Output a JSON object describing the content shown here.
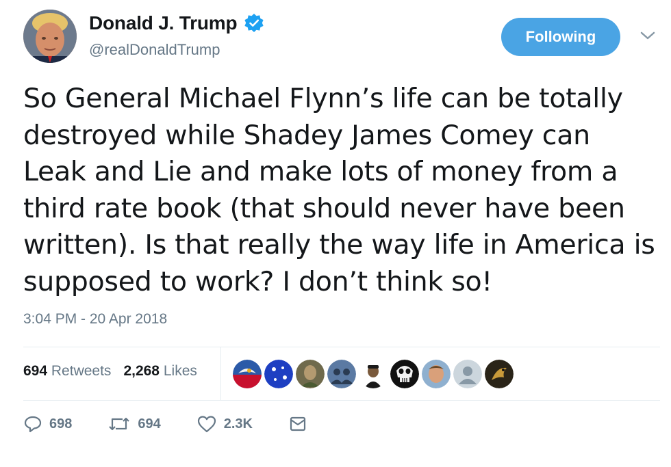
{
  "author": {
    "display_name": "Donald J. Trump",
    "handle": "@realDonaldTrump",
    "verified": true,
    "avatar_icon": "profile-photo"
  },
  "follow_button": {
    "label": "Following",
    "color": "#4aa4e4"
  },
  "tweet": {
    "text": "So General Michael Flynn’s life can be totally destroyed while Shadey James Comey can Leak and Lie and make lots of money from a third rate book (that should never have been written). Is that really the way life in America is supposed to work? I don’t think so!",
    "timestamp": "3:04 PM - 20 Apr 2018"
  },
  "stats": {
    "retweets_count": "694",
    "retweets_label": "Retweets",
    "likes_count": "2,268",
    "likes_label": "Likes"
  },
  "likers": [
    {
      "icon": "eagle-avatar",
      "color": "#2b5aa8"
    },
    {
      "icon": "blue-avatar",
      "color": "#1e3fc2"
    },
    {
      "icon": "camo-avatar",
      "color": "#6f6a4c"
    },
    {
      "icon": "group-avatar",
      "color": "#5b7aa3"
    },
    {
      "icon": "person-avatar",
      "color": "#7a5a3c"
    },
    {
      "icon": "skull-avatar",
      "color": "#111111"
    },
    {
      "icon": "face-avatar",
      "color": "#d9a07a"
    },
    {
      "icon": "default-avatar",
      "color": "#ccd6dd"
    },
    {
      "icon": "eagle-gold-avatar",
      "color": "#7a5a20"
    }
  ],
  "actions": {
    "reply_count": "698",
    "retweet_count": "694",
    "like_count": "2.3K"
  },
  "colors": {
    "text": "#14171a",
    "secondary": "#657786",
    "accent": "#1da1f2",
    "divider": "#e6ecf0"
  }
}
